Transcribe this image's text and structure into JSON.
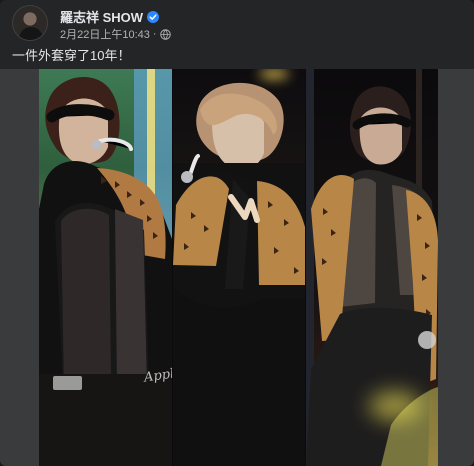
{
  "post": {
    "author": "羅志祥 SHOW",
    "timestamp": "2月22日上午10:43",
    "separator": "·",
    "caption": "一件外套穿了10年！"
  },
  "photo": {
    "jacket_text": "Apple"
  },
  "colors": {
    "card_bg": "#242526",
    "text_primary": "#e4e6eb",
    "text_secondary": "#b0b3b8",
    "verified_blue": "#2d88ff"
  },
  "icons": [
    "verified-icon",
    "globe-icon"
  ]
}
